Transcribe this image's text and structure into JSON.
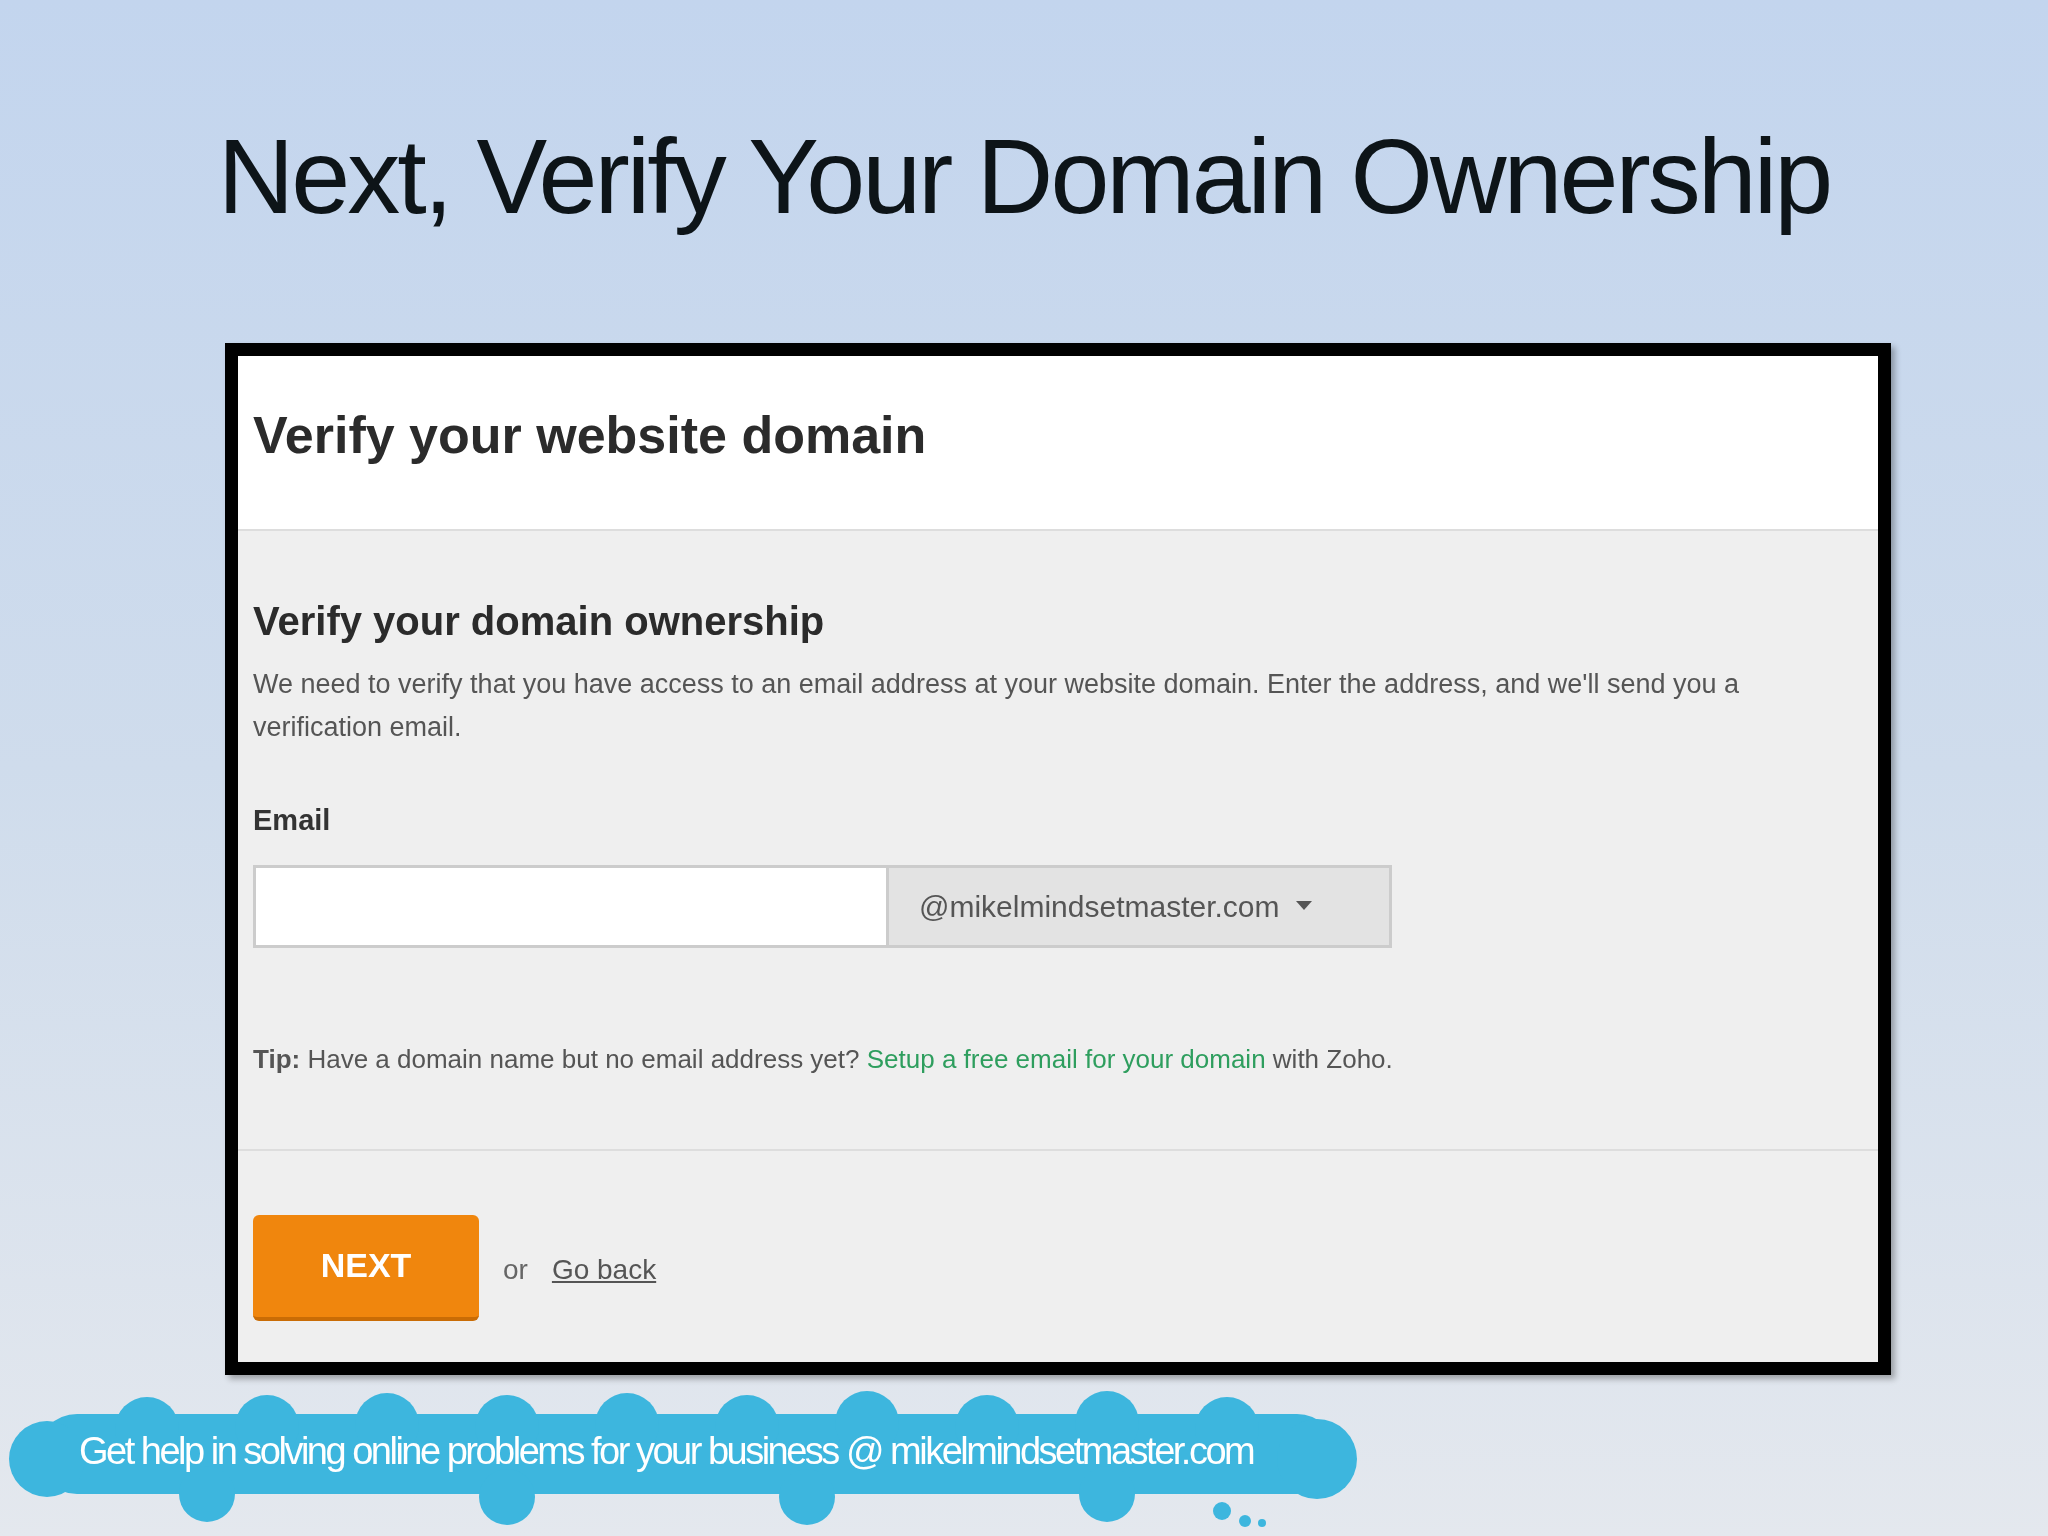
{
  "slide": {
    "title": "Next, Verify Your Domain Ownership",
    "banner": "Get help in solving online problems for your business @ mikelmindsetmaster.com"
  },
  "dialog": {
    "title": "Verify your website domain",
    "section_title": "Verify your domain ownership",
    "description": "We need to verify that you have access to an email address at your website domain. Enter the address, and we'll send you a verification email.",
    "email_label": "Email",
    "email_domain": "@mikelmindsetmaster.com",
    "tip": {
      "lead": "**Tip:** Have a domain name but no email address yet?",
      "link": "Setup a free email for your domain",
      "after": "with Zoho."
    },
    "next_button": "NEXT",
    "or_text": "or",
    "back_link": "Go back"
  }
}
